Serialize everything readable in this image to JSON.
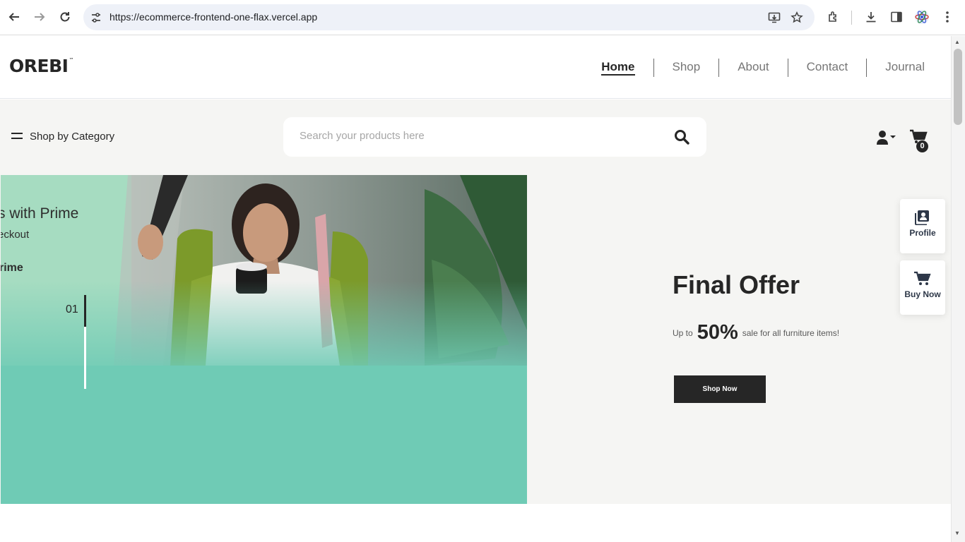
{
  "browser": {
    "url": "https://ecommerce-frontend-one-flax.vercel.app",
    "nav_icons": [
      "back-arrow-icon",
      "forward-arrow-icon",
      "reload-icon"
    ],
    "omnibox_icons": [
      "site-settings-icon",
      "install-app-icon",
      "bookmark-star-icon"
    ],
    "toolbar_icons": [
      "extensions-icon",
      "download-icon",
      "side-panel-icon",
      "profile-avatar-icon",
      "more-menu-icon"
    ]
  },
  "header": {
    "logo": "OREBI",
    "logo_mark": "™",
    "nav": [
      {
        "label": "Home",
        "active": true
      },
      {
        "label": "Shop",
        "active": false
      },
      {
        "label": "About",
        "active": false
      },
      {
        "label": "Contact",
        "active": false
      },
      {
        "label": "Journal",
        "active": false
      }
    ]
  },
  "toolbar": {
    "category_label": "Shop by Category",
    "search_placeholder": "Search your products here",
    "cart_count": "0"
  },
  "hero": {
    "line1": "s with Prime",
    "line2": "eckout",
    "line3": "rime",
    "slide_number": "01"
  },
  "offer": {
    "title": "Final Offer",
    "prefix": "Up to",
    "percent": "50%",
    "suffix": "sale for all furniture items!",
    "button": "Shop Now"
  },
  "side_actions": {
    "profile": "Profile",
    "buy_now": "Buy Now"
  },
  "colors": {
    "brand_dark": "#262626",
    "hero_bg": "#6fcbb5",
    "section_bg": "#f5f5f3",
    "omnibox_bg": "#eef1f8"
  }
}
